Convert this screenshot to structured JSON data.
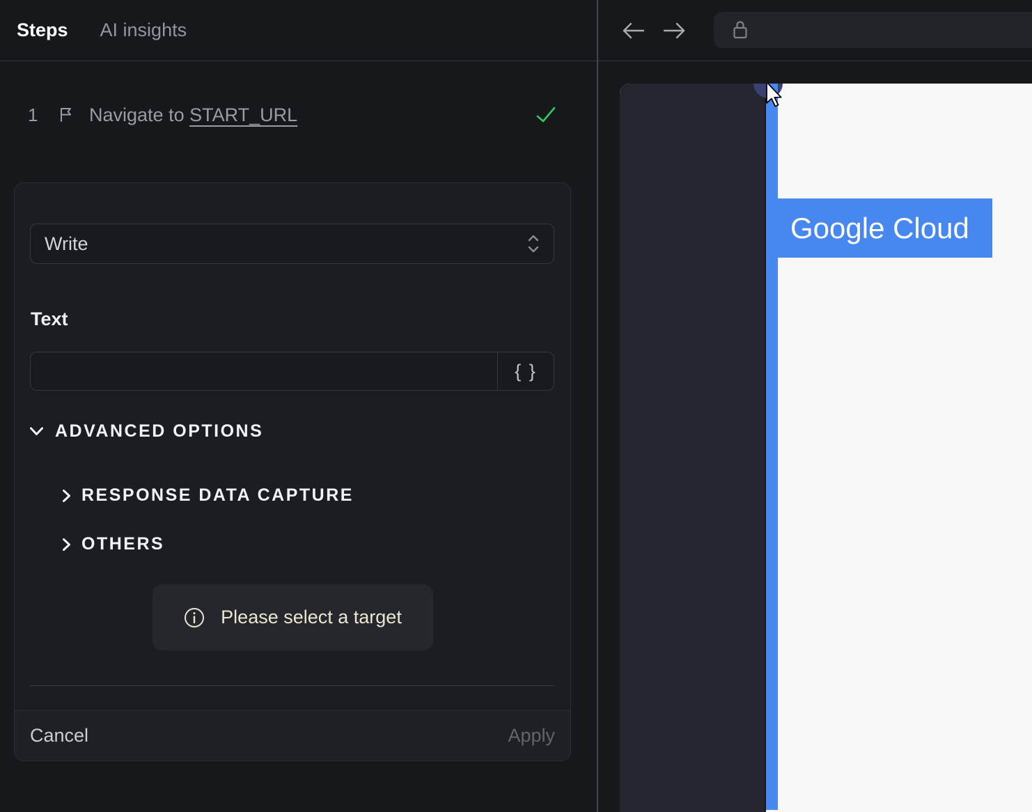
{
  "tabs": {
    "steps": "Steps",
    "ai_insights": "AI insights"
  },
  "step": {
    "number": "1",
    "label": "Navigate to ",
    "link": "START_URL"
  },
  "editor": {
    "action_select_value": "Write",
    "text_label": "Text",
    "text_input_value": "",
    "braces_button": "{ }",
    "advanced_options_label": "ADVANCED OPTIONS",
    "response_data_capture_label": "RESPONSE DATA CAPTURE",
    "others_label": "OTHERS",
    "notice_text": "Please select a target",
    "cancel_label": "Cancel",
    "apply_label": "Apply"
  },
  "browser": {
    "url_value": "",
    "page": {
      "logo_text": "Google Cloud"
    }
  },
  "colors": {
    "accent_blue": "#4787F0",
    "success_green": "#2FCD5D",
    "notice_cream": "#ECE5D1",
    "panel_dark": "#24262F",
    "circle_navy": "#3A4070"
  },
  "icons": [
    "flag-icon",
    "check-icon",
    "chevron-updown-icon",
    "chevron-down-icon",
    "chevron-right-icon",
    "braces-icon",
    "info-icon",
    "back-arrow-icon",
    "forward-arrow-icon",
    "lock-icon",
    "cursor-pointer-icon"
  ]
}
